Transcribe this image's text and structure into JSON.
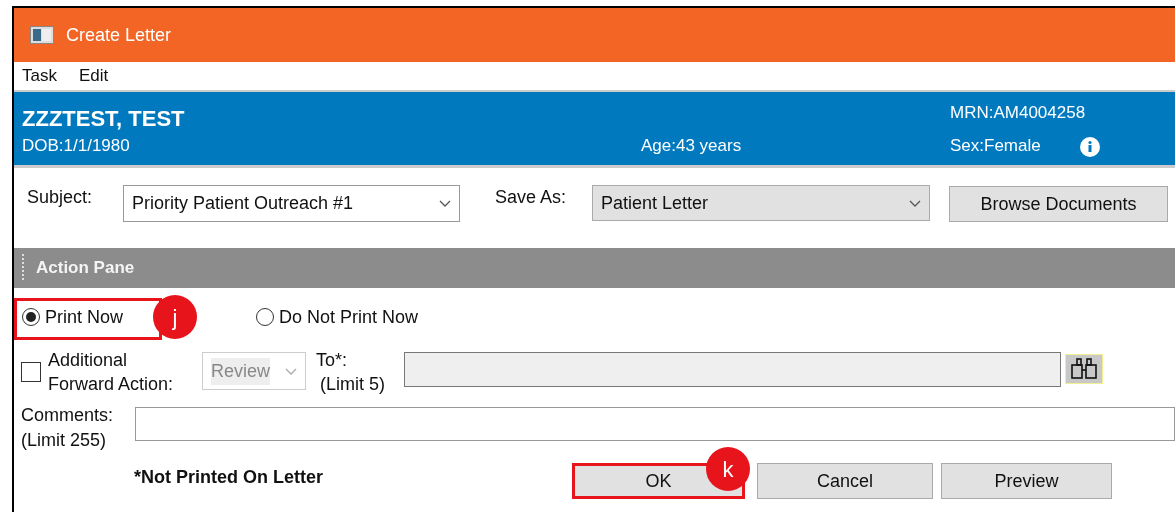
{
  "window": {
    "title": "Create Letter"
  },
  "menu": [
    "Task",
    "Edit"
  ],
  "patient": {
    "name": "ZZZTEST, TEST",
    "dob": "DOB:1/1/1980",
    "age": "Age:43 years",
    "mrn": "MRN:AM4004258",
    "sex": "Sex:Female"
  },
  "subject": {
    "label": "Subject:",
    "value": "Priority Patient Outreach #1"
  },
  "save_as": {
    "label": "Save As:",
    "value": "Patient Letter"
  },
  "browse_button": "Browse Documents",
  "action_pane": {
    "title": "Action Pane"
  },
  "print_options": [
    {
      "label": "Print Now",
      "selected": true
    },
    {
      "label": "Do Not Print Now",
      "selected": false
    }
  ],
  "forward": {
    "label": "Additional Forward Action:",
    "checked": false,
    "action": "Review",
    "action_disabled": true
  },
  "to": {
    "label": "To*:",
    "limit": "(Limit 5)"
  },
  "comments": {
    "label": "Comments:",
    "limit": "(Limit 255)"
  },
  "note": "*Not Printed On Letter",
  "buttons": [
    "OK",
    "Cancel",
    "Preview"
  ],
  "callouts": [
    {
      "label": "j"
    },
    {
      "label": "k"
    }
  ]
}
